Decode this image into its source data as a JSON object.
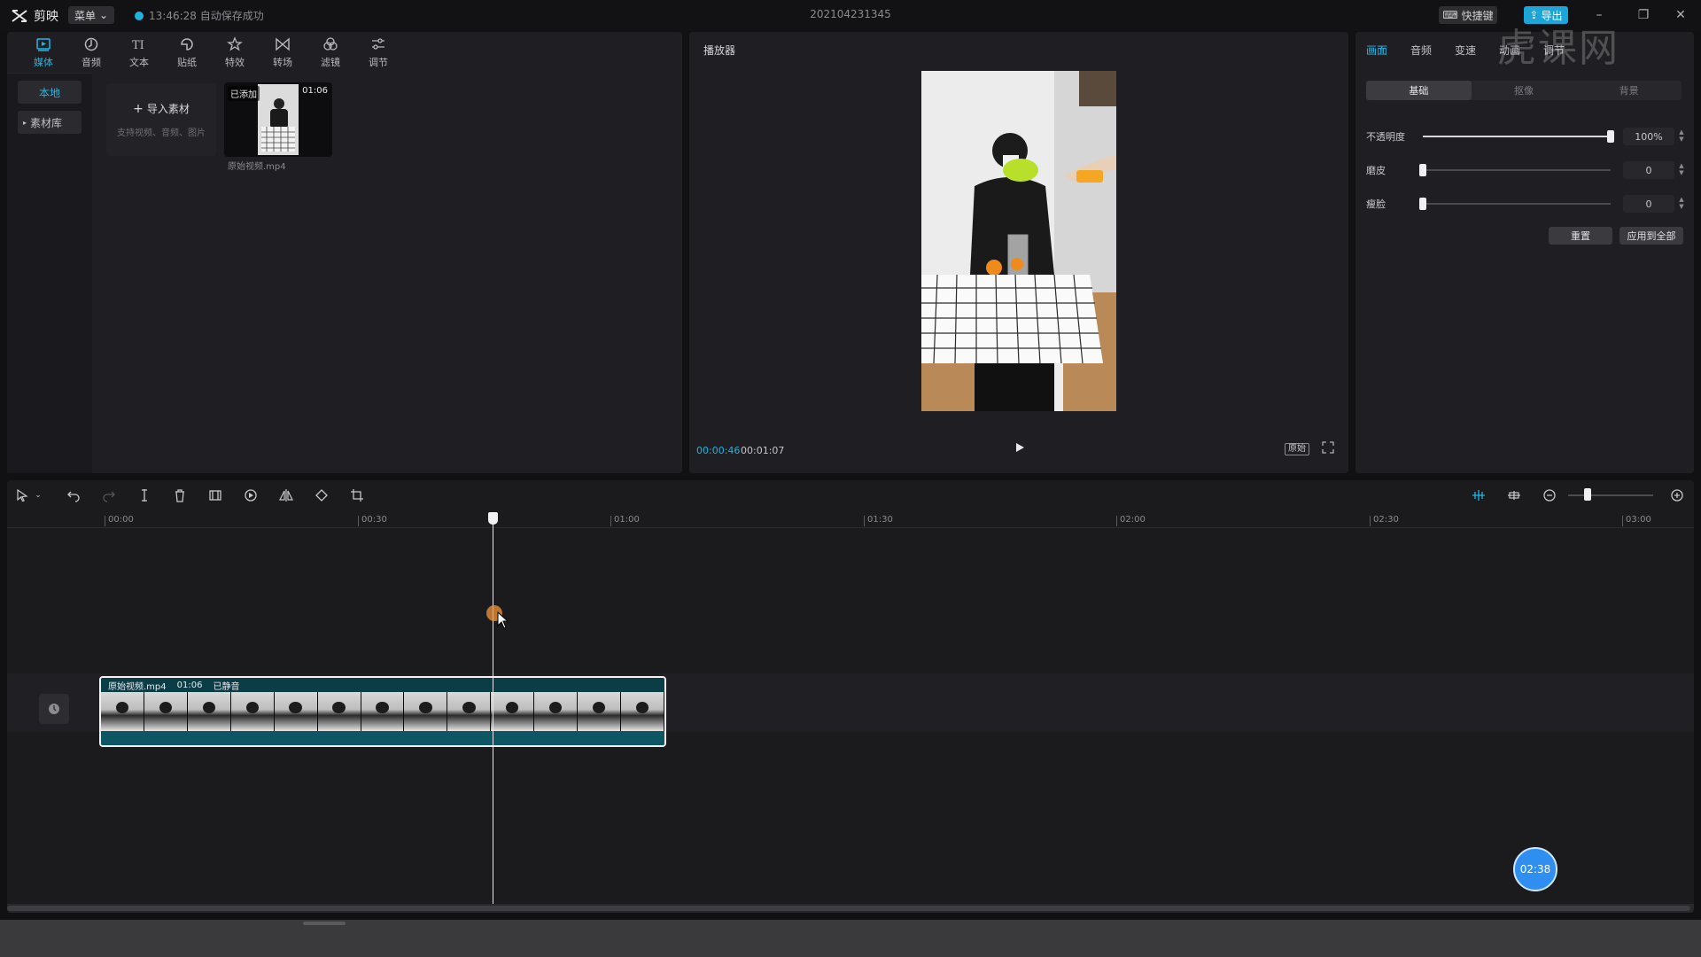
{
  "app": {
    "name": "剪映",
    "menu_label": "菜单",
    "save_status": "13:46:28 自动保存成功",
    "doc_title": "202104231345",
    "shortcut_label": "快捷键",
    "export_label": "导出"
  },
  "media": {
    "tabs": [
      {
        "label": "媒体",
        "icon": "media-icon"
      },
      {
        "label": "音频",
        "icon": "audio-icon"
      },
      {
        "label": "文本",
        "icon": "text-icon"
      },
      {
        "label": "贴纸",
        "icon": "sticker-icon"
      },
      {
        "label": "特效",
        "icon": "effects-icon"
      },
      {
        "label": "转场",
        "icon": "transition-icon"
      },
      {
        "label": "滤镜",
        "icon": "filter-icon"
      },
      {
        "label": "调节",
        "icon": "adjust-icon"
      }
    ],
    "side": {
      "local": "本地",
      "library": "素材库"
    },
    "import": {
      "label": "导入素材",
      "sub": "支持视频、音频、图片"
    },
    "clip": {
      "added": "已添加",
      "duration": "01:06",
      "name": "原始视频.mp4"
    }
  },
  "player": {
    "title": "播放器",
    "current_time": "00:00:46",
    "total_time": "00:01:07",
    "ratio_label": "原始"
  },
  "props": {
    "tabs": [
      "画面",
      "音频",
      "变速",
      "动画",
      "调节"
    ],
    "subtabs": [
      "基础",
      "抠像",
      "背景"
    ],
    "rows": [
      {
        "label": "不透明度",
        "value": "100%",
        "level": 1.0
      },
      {
        "label": "磨皮",
        "value": "0",
        "level": 0
      },
      {
        "label": "瘦脸",
        "value": "0",
        "level": 0
      }
    ],
    "reset_label": "重置",
    "apply_label": "应用到全部"
  },
  "watermark": "虎课网",
  "timeline": {
    "ticks": [
      "00:00",
      "00:30",
      "01:00",
      "01:30",
      "02:00",
      "02:30",
      "03:00"
    ],
    "clip": {
      "name": "原始视频.mp4",
      "duration": "01:06",
      "status": "已静音"
    },
    "time_bubble": "02:38"
  },
  "colors": {
    "accent": "#21b6e6",
    "export": "#1ea5d8",
    "clip": "#0f5e6c",
    "bubble": "#2f8ff0"
  }
}
